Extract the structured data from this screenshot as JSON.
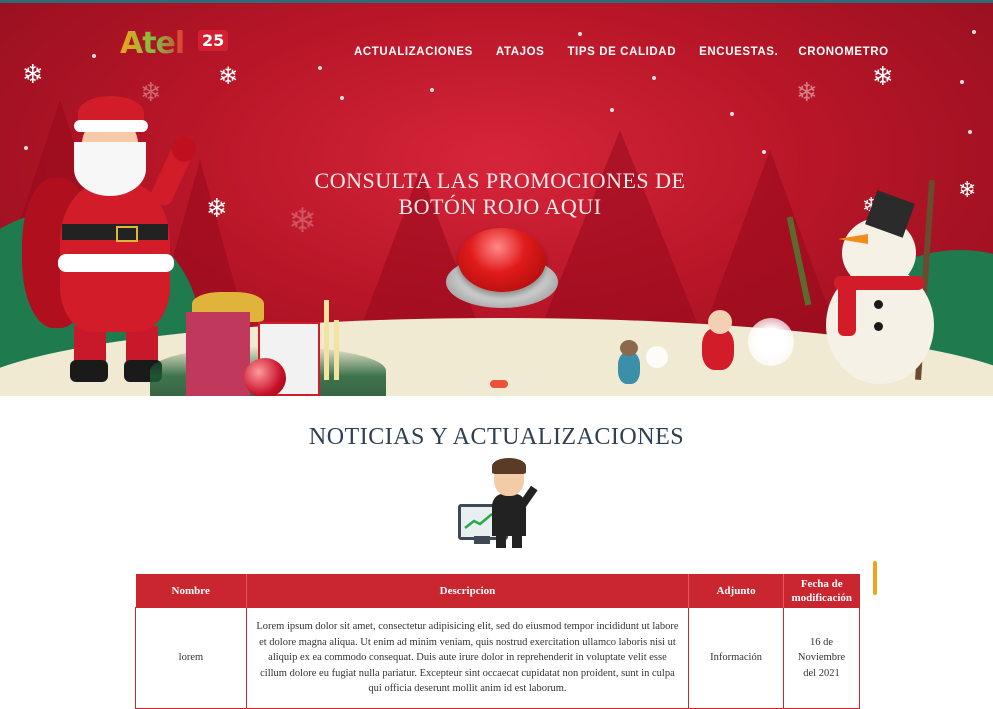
{
  "brand": {
    "logo_text": "Atel",
    "logo_badge": "25",
    "colors": {
      "primary": "#c9262f",
      "accent": "#e8553a"
    }
  },
  "nav": {
    "items": [
      {
        "label": "ACTUALIZACIONES"
      },
      {
        "label": "ATAJOS"
      },
      {
        "label": "TIPS DE CALIDAD"
      },
      {
        "label": "ENCUESTAS."
      },
      {
        "label": "CRONOMETRO"
      }
    ]
  },
  "hero": {
    "headline_line1": "CONSULTA LAS PROMOCIONES DE",
    "headline_line2": "BOTÓN ROJO AQUI",
    "carousel_active_index": 1,
    "carousel_count": 3
  },
  "news": {
    "title": "NOTICIAS Y ACTUALIZACIONES",
    "illustration_icon": "businessman-chart-icon",
    "columns": [
      "Nombre",
      "Descripcion",
      "Adjunto",
      "Fecha de modificación"
    ],
    "rows": [
      {
        "nombre": "lorem",
        "descripcion": "Lorem ipsum dolor sit amet, consectetur adipisicing elit, sed do eiusmod tempor incididunt ut labore et dolore magna aliqua. Ut enim ad minim veniam, quis nostrud exercitation ullamco laboris nisi ut aliquip ex ea commodo consequat. Duis aute irure dolor in reprehenderit in voluptate velit esse cillum dolore eu fugiat nulla pariatur. Excepteur sint occaecat cupidatat non proident, sunt in culpa qui officia deserunt mollit anim id est laborum.",
        "adjunto": "Información",
        "fecha": "16 de Noviembre del 2021"
      }
    ]
  }
}
